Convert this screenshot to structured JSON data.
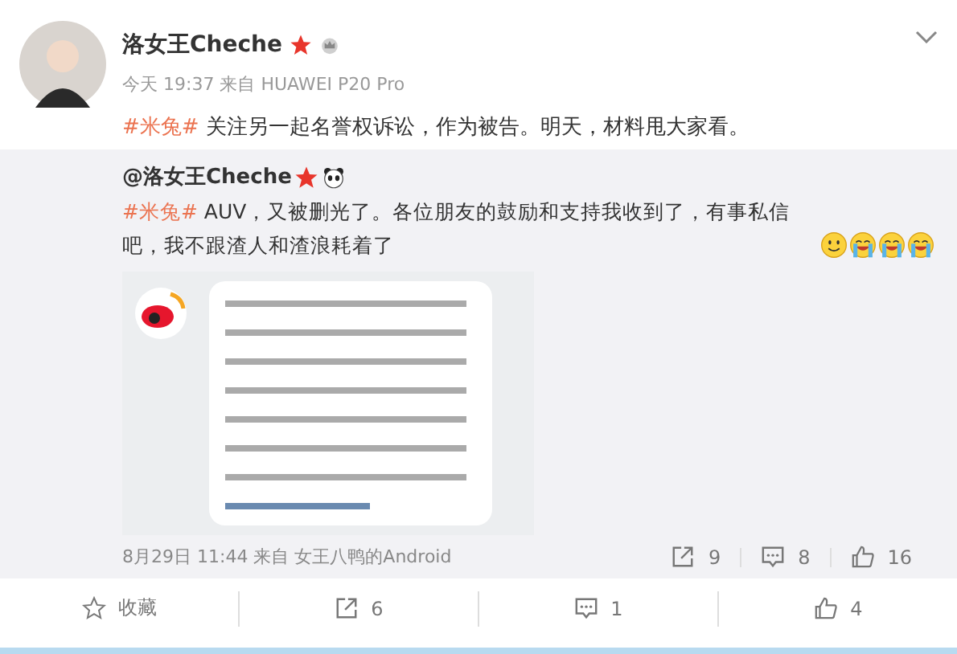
{
  "post": {
    "author": "洛女王Cheche",
    "meta": "今天 19:37 来自 HUAWEI P20 Pro",
    "topic": "#米兔#",
    "text": " 关注另一起名誉权诉讼，作为被告。明天，材料甩大家看。"
  },
  "repost": {
    "author": "@洛女王Cheche",
    "topic": "#米兔#",
    "text": " AUV，又被删光了。各位朋友的鼓励和支持我收到了，有事私信吧，我不跟渣人和渣浪耗着了",
    "meta": "8月29日 11:44 来自 女王八鸭的Android",
    "stats": [
      {
        "kind": "share",
        "count": "9"
      },
      {
        "kind": "comment",
        "count": "8"
      },
      {
        "kind": "like",
        "count": "16"
      }
    ]
  },
  "actions": [
    {
      "kind": "favorite",
      "label": "收藏"
    },
    {
      "kind": "share",
      "label": "6"
    },
    {
      "kind": "comment",
      "label": "1"
    },
    {
      "kind": "like",
      "label": "4"
    }
  ]
}
